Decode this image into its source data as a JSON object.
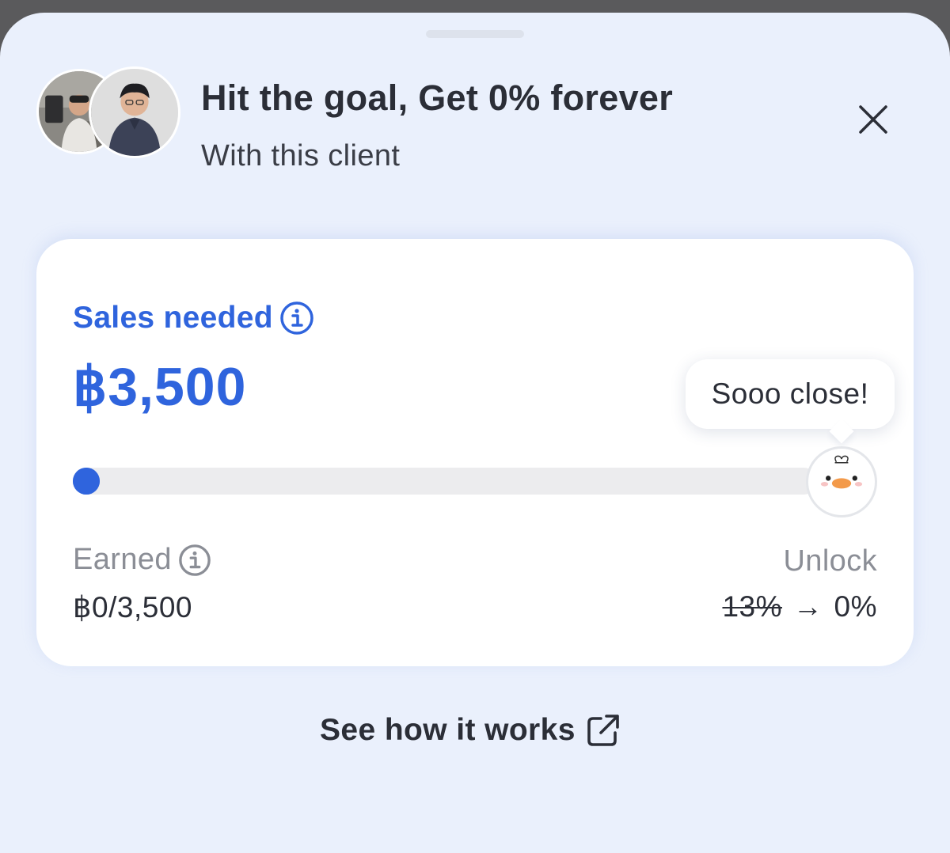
{
  "header": {
    "title": "Hit the goal, Get 0% forever",
    "subtitle": "With this client"
  },
  "avatars": [
    {
      "name": "avatar-client-1"
    },
    {
      "name": "avatar-client-2"
    }
  ],
  "icons": {
    "close": "close-icon",
    "info": "info-icon",
    "external_link": "external-link-icon",
    "mascot": "duck-mascot-icon"
  },
  "goal": {
    "label": "Sales needed",
    "amount": "฿3,500",
    "progress_fraction": 0.0,
    "bubble_text": "Sooo close!"
  },
  "earned": {
    "label": "Earned",
    "value": "฿0/3,500"
  },
  "unlock": {
    "label": "Unlock",
    "old_rate": "13%",
    "arrow": "→",
    "new_rate": "0%"
  },
  "footer": {
    "link_label": "See how it works"
  },
  "colors": {
    "accent": "#2f64dd",
    "sheet_background": "#eaf0fc",
    "track": "#ececee",
    "text_primary": "#2b2e37",
    "text_muted": "#8b8e96"
  }
}
